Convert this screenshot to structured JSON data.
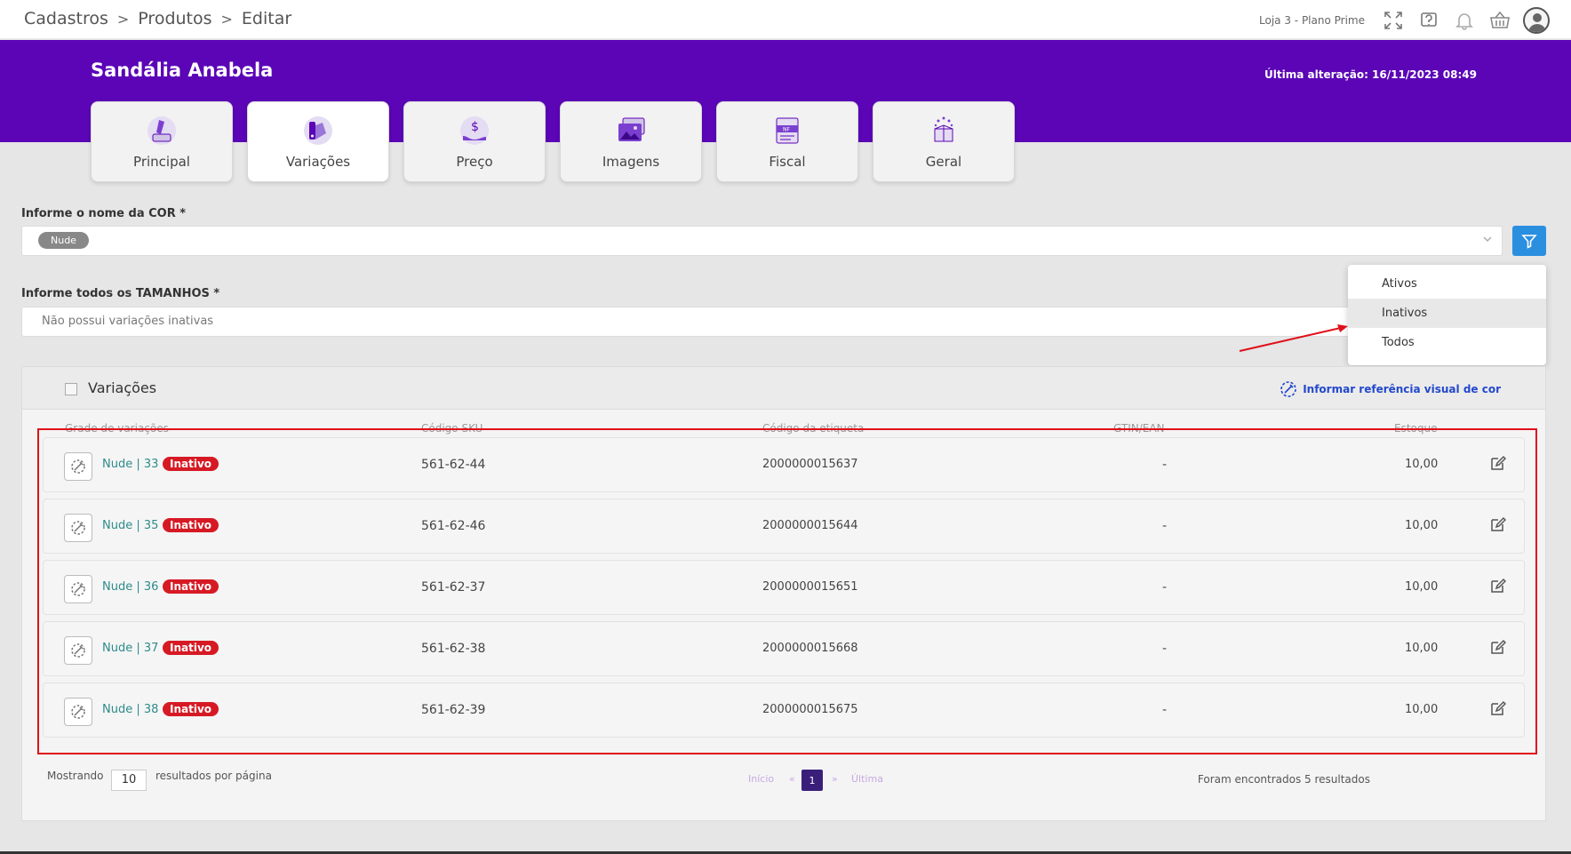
{
  "breadcrumb": {
    "a": "Cadastros",
    "b": "Produtos",
    "c": "Editar",
    "sep": ">"
  },
  "store": "Loja 3 - Plano Prime",
  "product": {
    "title": "Sandália Anabela",
    "last_change": "Última alteração: 16/11/2023 08:49"
  },
  "tabs": {
    "t0": "Principal",
    "t1": "Variações",
    "t2": "Preço",
    "t3": "Imagens",
    "t4": "Fiscal",
    "t5": "Geral",
    "fiscal_badge": "NF"
  },
  "cor": {
    "label": "Informe o nome da COR *",
    "chip": "Nude"
  },
  "tamanhos": {
    "label": "Informe todos os TAMANHOS *",
    "placeholder": "Não possui variações inativas"
  },
  "dropdown": {
    "i0": "Ativos",
    "i1": "Inativos",
    "i2": "Todos"
  },
  "panel": {
    "title": "Variações",
    "ref_link": "Informar referência visual de cor"
  },
  "columns": {
    "c0": "Grade de variações",
    "c1": "Código SKU",
    "c2": "Código da etiqueta",
    "c3": "GTIN/EAN",
    "c4": "Estoque"
  },
  "rows": [
    {
      "name": "Nude | 33",
      "badge": "Inativo",
      "sku": "561-62-44",
      "label": "2000000015637",
      "gtin": "-",
      "stock": "10,00"
    },
    {
      "name": "Nude | 35",
      "badge": "Inativo",
      "sku": "561-62-46",
      "label": "2000000015644",
      "gtin": "-",
      "stock": "10,00"
    },
    {
      "name": "Nude | 36",
      "badge": "Inativo",
      "sku": "561-62-37",
      "label": "2000000015651",
      "gtin": "-",
      "stock": "10,00"
    },
    {
      "name": "Nude | 37",
      "badge": "Inativo",
      "sku": "561-62-38",
      "label": "2000000015668",
      "gtin": "-",
      "stock": "10,00"
    },
    {
      "name": "Nude | 38",
      "badge": "Inativo",
      "sku": "561-62-39",
      "label": "2000000015675",
      "gtin": "-",
      "stock": "10,00"
    }
  ],
  "pagination": {
    "showing": "Mostrando",
    "per_page": "10",
    "per_page_suffix": "resultados por página",
    "first": "Início",
    "prev": "«",
    "current": "1",
    "next": "»",
    "last": "Última",
    "found": "Foram encontrados 5 resultados"
  },
  "colors": {
    "accent": "#5b05b7",
    "badge": "#d61a24",
    "link": "#2248cc",
    "teal": "#2e8b8b",
    "highlight": "#e0101a"
  }
}
